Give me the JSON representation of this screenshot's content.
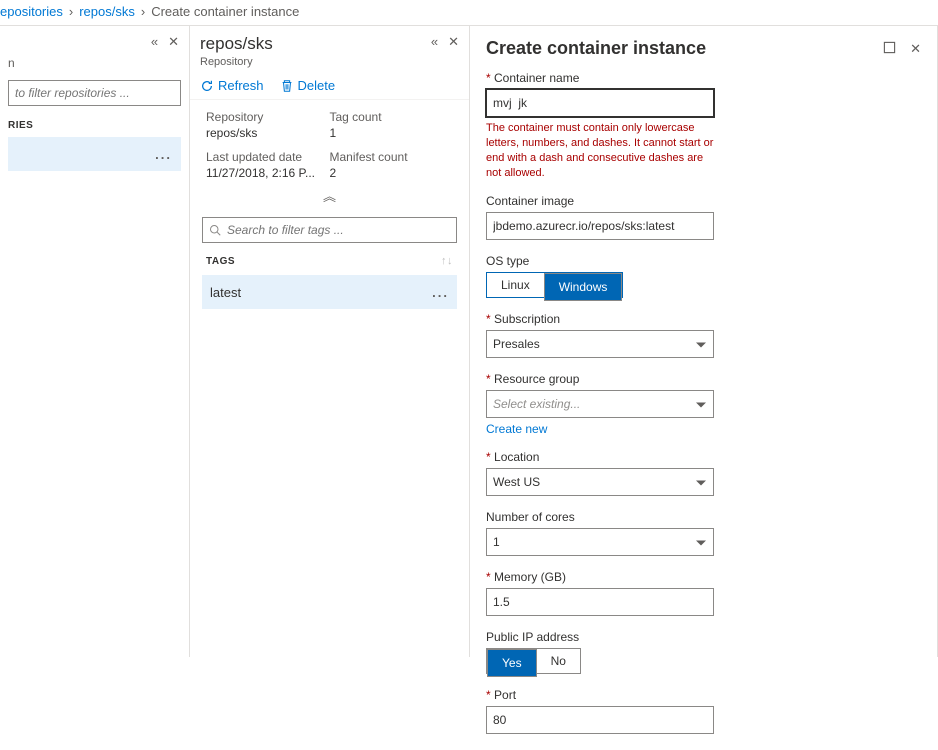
{
  "breadcrumb": {
    "items": [
      "epositories",
      "repos/sks"
    ],
    "current": "Create container instance"
  },
  "pane1": {
    "placeholder_label": "n",
    "filter_placeholder": "to filter repositories ...",
    "category_label": "RIES",
    "selected_item": ""
  },
  "pane2": {
    "title": "repos/sks",
    "subtitle": "Repository",
    "toolbar": {
      "refresh": "Refresh",
      "delete": "Delete"
    },
    "meta": {
      "repo_label": "Repository",
      "repo_value": "repos/sks",
      "tagcount_label": "Tag count",
      "tagcount_value": "1",
      "updated_label": "Last updated date",
      "updated_value": "11/27/2018, 2:16 P...",
      "manifest_label": "Manifest count",
      "manifest_value": "2"
    },
    "search_placeholder": "Search to filter tags ...",
    "tags_header": "TAGS",
    "tags": [
      {
        "label": "latest"
      }
    ]
  },
  "pane3": {
    "title": "Create container instance",
    "fields": {
      "container_name": {
        "label": "Container name",
        "value": "mvj  jk",
        "error": "The container must contain only lowercase letters, numbers, and dashes. It cannot start or end with a dash and consecutive dashes are not allowed."
      },
      "container_image": {
        "label": "Container image",
        "value": "jbdemo.azurecr.io/repos/sks:latest"
      },
      "os_type": {
        "label": "OS type",
        "options": [
          "Linux",
          "Windows"
        ],
        "selected": "Windows"
      },
      "subscription": {
        "label": "Subscription",
        "value": "Presales"
      },
      "resource_group": {
        "label": "Resource group",
        "placeholder": "Select existing...",
        "link": "Create new"
      },
      "location": {
        "label": "Location",
        "value": "West US"
      },
      "cores": {
        "label": "Number of cores",
        "value": "1"
      },
      "memory": {
        "label": "Memory (GB)",
        "value": "1.5"
      },
      "public_ip": {
        "label": "Public IP address",
        "options": [
          "Yes",
          "No"
        ],
        "selected": "Yes"
      },
      "port": {
        "label": "Port",
        "value": "80"
      }
    }
  }
}
